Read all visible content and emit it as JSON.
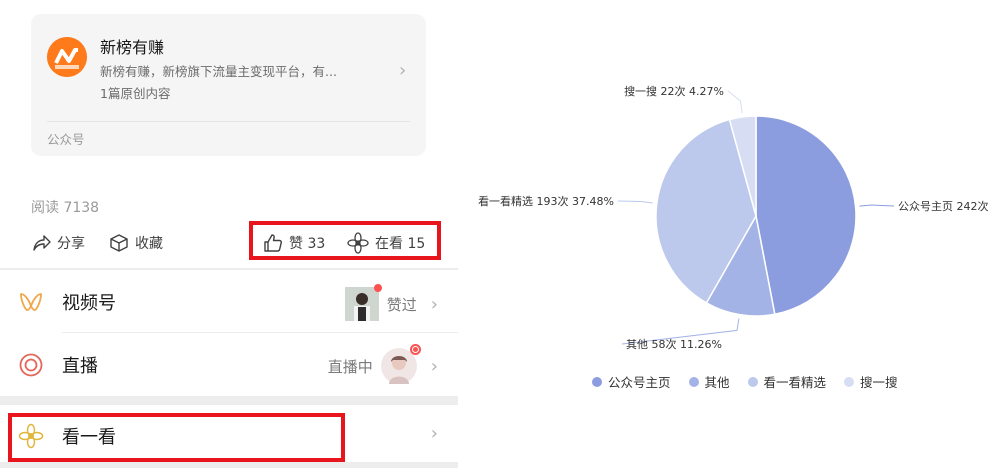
{
  "account": {
    "name": "新榜有赚",
    "description": "新榜有赚，新榜旗下流量主变现平台，有...",
    "count": "1篇原创内容",
    "footer": "公众号"
  },
  "stats": {
    "read": "阅读 7138",
    "share": "分享",
    "collect": "收藏",
    "like": "赞 33",
    "watching": "在看 15"
  },
  "rows": {
    "channels": {
      "label": "视频号",
      "status": "赞过"
    },
    "live": {
      "label": "直播",
      "status": "直播中"
    },
    "kanyikan": {
      "label": "看一看"
    }
  },
  "icons": {
    "share": "share-arrow-icon",
    "collect": "cube-icon",
    "like": "thumbs-up-icon",
    "watching": "flower-icon",
    "channels": "channels-butterfly-icon",
    "live": "live-ring-icon",
    "kanyikan": "kanyikan-flower-icon"
  },
  "colors": {
    "highlight": "#e8161c",
    "slice1": "#8b9ddf",
    "slice2": "#a3b3e6",
    "slice3": "#bcc8ec",
    "slice4": "#d7def4"
  },
  "chart_data": {
    "type": "pie",
    "series": [
      {
        "name": "公众号主页",
        "value": 242,
        "label": "公众号主页 242次"
      },
      {
        "name": "其他",
        "value": 58,
        "label": "其他 58次 11.26%"
      },
      {
        "name": "看一看精选",
        "value": 193,
        "label": "看一看精选 193次 37.48%"
      },
      {
        "name": "搜一搜",
        "value": 22,
        "label": "搜一搜 22次 4.27%"
      }
    ],
    "legend": [
      "公众号主页",
      "其他",
      "看一看精选",
      "搜一搜"
    ],
    "legend_position": "bottom"
  }
}
